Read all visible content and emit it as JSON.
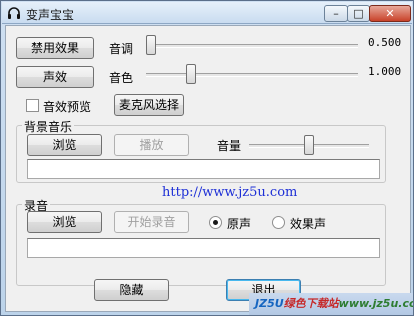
{
  "window": {
    "title": "变声宝宝",
    "min": "–",
    "max": "□",
    "close": "✕"
  },
  "buttons": {
    "disable_effect": "禁用效果",
    "sound_effect": "声效",
    "mic_select": "麦克风选择",
    "hide": "隐藏",
    "exit": "退出"
  },
  "sliders": {
    "pitch": {
      "label": "音调",
      "value_text": "0.500",
      "level": 0.0
    },
    "timbre": {
      "label": "音色",
      "value_text": "1.000",
      "level": 0.2
    }
  },
  "preview": {
    "label": "音效预览",
    "checked": false
  },
  "bgm": {
    "title": "背景音乐",
    "browse": "浏览",
    "play": "播放",
    "volume_label": "音量",
    "volume_level": 0.5,
    "path": ""
  },
  "url": "http://www.jz5u.com",
  "recording": {
    "title": "录音",
    "browse": "浏览",
    "start": "开始录音",
    "opt_original": "原声",
    "opt_effect": "效果声",
    "selected": "原声",
    "path": ""
  },
  "watermark": {
    "part1": "JZ5U",
    "part2": "绿色下载站",
    "part3": "www.jz5u.com"
  }
}
